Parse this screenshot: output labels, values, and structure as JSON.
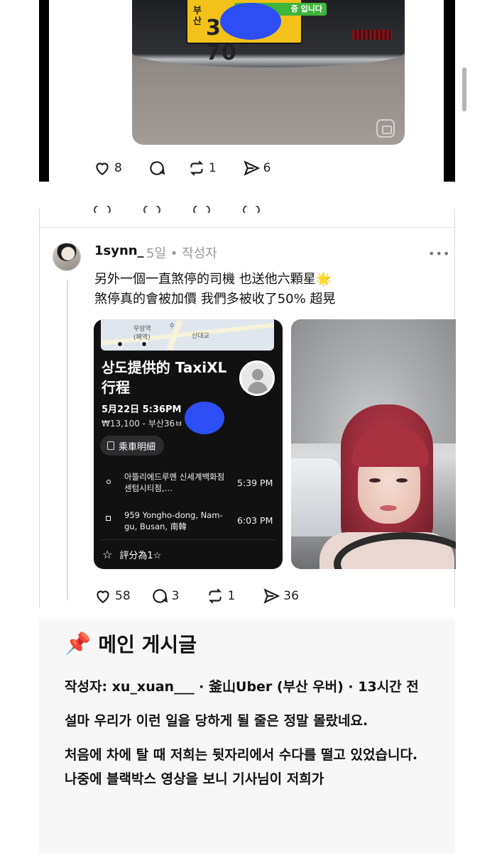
{
  "top_post": {
    "plate": {
      "region": "부산",
      "number_visible_start": "3",
      "number_visible_end": "70",
      "sticker_text": "중 입니다"
    },
    "likes": "8",
    "reposts": "1",
    "shares": "6"
  },
  "reply_post": {
    "username": "1synn_",
    "meta": "5일 • 작성자",
    "more": "•••",
    "text_line1": "另外一個一直煞停的司機 也送他六顆星",
    "sparkle": "🌟",
    "text_line2": "煞停真的會被加價 我們多被收了50% 超晃",
    "receipt": {
      "map_labels": [
        "우암역",
        "(폐역)",
        "수",
        "산대교"
      ],
      "title": "상도提供的 TaxiXL 行程",
      "date": "5月22日 5:36PM",
      "fare": "₩13,100 - 부산36ㅂ",
      "detail_button": "乘車明細",
      "pickup_address": "아뜰리에드루멘 신세계백화점센텀시티점,…",
      "pickup_time": "5:39 PM",
      "dropoff_address": "959 Yongho-dong, Nam-gu, Busan, 南韓",
      "dropoff_time": "6:03 PM",
      "rating": "評分為1☆",
      "rating_icon": "☆"
    },
    "likes": "58",
    "comments": "3",
    "reposts": "1",
    "shares": "36"
  },
  "main_post": {
    "pin": "📌",
    "title": "메인 게시글",
    "byline": "작성자: xu_xuan___ · 釜山Uber (부산 우버) · 13시간 전",
    "para1": "설마 우리가 이런 일을 당하게 될 줄은 정말 몰랐네요.",
    "para2": "처음에 차에 탈 때 저희는 뒷자리에서 수다를 떨고 있었습니다.",
    "para3": "나중에 블랙박스 영상을 보니 기사님이 저희가"
  },
  "colors": {
    "censor_blue": "#2d4ef5",
    "plate_yellow": "#f2c21b",
    "receipt_bg": "#111112",
    "meta_gray": "#999999"
  }
}
